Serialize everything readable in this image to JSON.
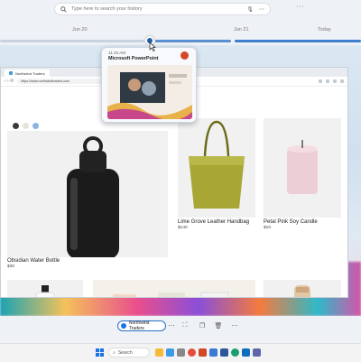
{
  "search": {
    "placeholder": "Type here to search your history"
  },
  "timeline": {
    "labels": [
      "Jun 20",
      "Jun 21",
      "Today"
    ]
  },
  "preview": {
    "time": "11:45 AM",
    "app_name": "Microsoft PowerPoint"
  },
  "browser": {
    "tab_title": "Northwind Traders",
    "url": "https://www.northwindtraders.com"
  },
  "products": [
    {
      "name": "Obsidian  Water Bottle",
      "price": "$30"
    },
    {
      "name": "Lime Grove Leather Handbag",
      "price": "$140"
    },
    {
      "name": "Petal Pink Soy Candle",
      "price": "$10"
    }
  ],
  "swatches": [
    "#3a3a3a",
    "#e8e3da",
    "#8ab4de"
  ],
  "chip": {
    "label": "Northwind Traders"
  },
  "taskbar": {
    "search_label": "Search"
  },
  "colors": {
    "accent": "#1f5fa8",
    "chip_border": "#2a6fc9"
  },
  "icons": [
    "search-icon",
    "mic-icon",
    "more-icon",
    "copy-icon",
    "delete-icon",
    "windows-start-icon"
  ]
}
